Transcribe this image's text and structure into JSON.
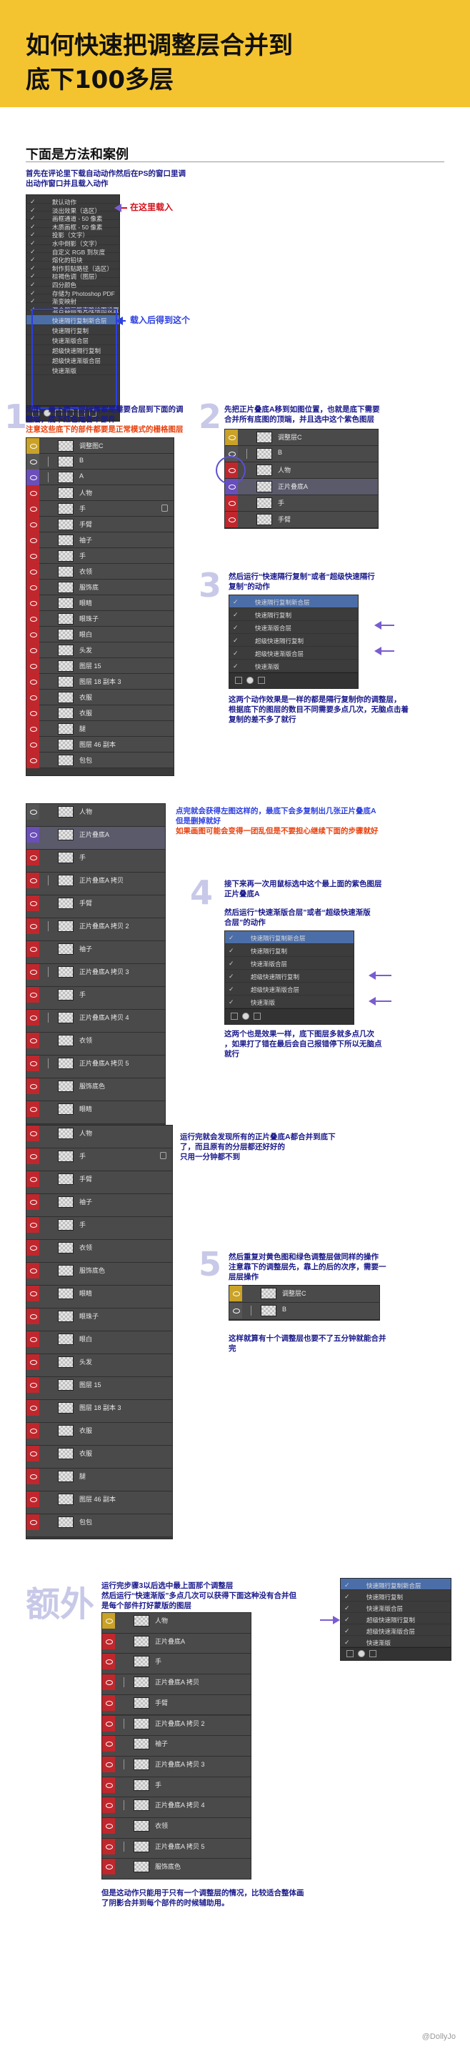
{
  "header": {
    "title_line1": "如何快速把调整层合并到",
    "title_line2": "底下100多层",
    "bg": "#f4c430"
  },
  "section": {
    "title": "下面是方法和案例"
  },
  "intro": {
    "text1": "首先在评论里下载自动动作然后在PS的窗口里调",
    "text2": "出动作窗口并且载入动作",
    "label_load_here": "在这里载入",
    "label_after_load": "载入后得到这个"
  },
  "step1": {
    "num": "1",
    "text1": "如图，最上面三层绿黄紫是需要合层到下面的调",
    "text2": "整层，底下红色是各个部件",
    "warn": "注意这些底下的部件都要是正常模式的栅格图层"
  },
  "step2": {
    "num": "2",
    "text1": "先把正片叠底A移到如图位置，也就是底下需要",
    "text2": "合并所有底图的顶端，并且选中这个紫色图层"
  },
  "step3": {
    "num": "3",
    "text1": "然后运行“快速隔行复制”或者“超级快速隔行",
    "text2": "复制”的动作",
    "text3": "这两个动作效果是一样的都是隔行复制你的调整层，",
    "text4": "根据底下的图层的数目不同需要多点几次，无脑点击着",
    "text5": "复制的差不多了就行"
  },
  "step4": {
    "num": "4",
    "click_text1": "点完就会获得左图这样的，最底下会多复制出几张正片叠底A",
    "click_text2": "但是删掉就好",
    "click_warn": "如果画图可能会变得一团乱但是不要担心继续下面的步骤就好",
    "text1": "接下来再一次用鼠标选中这个最上面的紫色图层",
    "text2": "正片叠底A",
    "text3": "然后运行“快速渐版合层”或者“超级快速渐版",
    "text4": "合层”的动作",
    "text5": "这两个也是效果一样，底下图层多就多点几次",
    "text6": "，如果打了错在最后会自己报错停下所以无脑点",
    "text7": "就行"
  },
  "step4b": {
    "text1": "运行完就会发现所有的正片叠底A都合并到底下",
    "text2": "了，而且原有的分层都还好好的",
    "text3": "只用一分钟都不到"
  },
  "step5": {
    "num": "5",
    "text1": "然后重复对黄色图和绿色调整层做同样的操作",
    "text2": "注意靠下的调整层先，靠上的后的次序，需要一",
    "text3": "层层操作",
    "text4": "这样就算有十个调整层也要不了五分钟就能合并",
    "text5": "完"
  },
  "extra": {
    "title": "额外",
    "text1": "运行完步骤3以后选中最上面那个调整层",
    "text2": "然后运行“快速渐版”多点几次可以获得下面这种没有合并但",
    "text3": "是每个部件打好蒙版的图层",
    "text4": "但是这动作只能用于只有一个调整层的情况，比较适合整体画",
    "text5": "了阴影合并到每个部件的时候辅助用。"
  },
  "panels": {
    "actions_top": [
      "默认动作",
      "淡出效果（选区）",
      "画框通道 - 50 像素",
      "木质画框 - 50 像素",
      "投影（文字）",
      "水中倒影（文字）",
      "自定义 RGB 到灰度",
      "熔化的铅块",
      "制作剪贴路径（选区）",
      "棕褐色调（图层）",
      "四分颜色",
      "存储为 Photoshop PDF",
      "渐变映射",
      "混合器画笔克隆绘图设置"
    ],
    "actions_loaded": [
      "快速隔行复制新合层",
      "快速隔行复制",
      "快速渐版合层",
      "超级快速隔行复制",
      "超级快速渐版合层",
      "快速渐版"
    ],
    "layers_step1": [
      "调整图C",
      "B",
      "A",
      "人物",
      "手",
      "手臂",
      "袖子",
      "手",
      "衣领",
      "服饰底",
      "眼睛",
      "眼珠子",
      "眼白",
      "头发",
      "图层 15",
      "图层 18 副本 3",
      "衣服",
      "衣服",
      "腿",
      "图层 46 副本",
      "包包"
    ],
    "layers_step2": [
      "调整层C",
      "B",
      "人物",
      "正片叠底A",
      "手",
      "手臂"
    ],
    "actions_step3": [
      "快速隔行复制新合层",
      "快速隔行复制",
      "快速渐版合层",
      "超级快速隔行复制",
      "超级快速渐版合层",
      "快速渐版"
    ],
    "layers_step4": [
      "人物",
      "正片叠底A",
      "手",
      "正片叠底A 拷贝",
      "手臂",
      "正片叠底A 拷贝 2",
      "袖子",
      "正片叠底A 拷贝 3",
      "手",
      "正片叠底A 拷贝 4",
      "衣领",
      "正片叠底A 拷贝 5",
      "服饰底色",
      "眼睛"
    ],
    "actions_step4": [
      "快速隔行复制新合层",
      "快速隔行复制",
      "快速渐版合层",
      "超级快速隔行复制",
      "超级快速渐版合层",
      "快速渐版"
    ],
    "layers_step4b": [
      "人物",
      "手",
      "手臂",
      "袖子",
      "手",
      "衣领",
      "服饰底色",
      "眼睛",
      "眼珠子",
      "眼白",
      "头发",
      "图层 15",
      "图层 18 副本 3",
      "衣服",
      "衣服",
      "腿",
      "图层 46 副本",
      "包包"
    ],
    "layers_step5": [
      "调整层C",
      "B"
    ],
    "layers_extra": [
      "人物",
      "正片叠底A",
      "手",
      "正片叠底A 拷贝",
      "手臂",
      "正片叠底A 拷贝 2",
      "袖子",
      "正片叠底A 拷贝 3",
      "手",
      "正片叠底A 拷贝 4",
      "衣领",
      "正片叠底A 拷贝 5",
      "服饰底色"
    ],
    "actions_extra": [
      "快速隔行复制新合层",
      "快速隔行复制",
      "快速渐版合层",
      "超级快速隔行复制",
      "超级快速渐版合层",
      "快速渐版"
    ]
  },
  "watermark": "@DollyJo"
}
